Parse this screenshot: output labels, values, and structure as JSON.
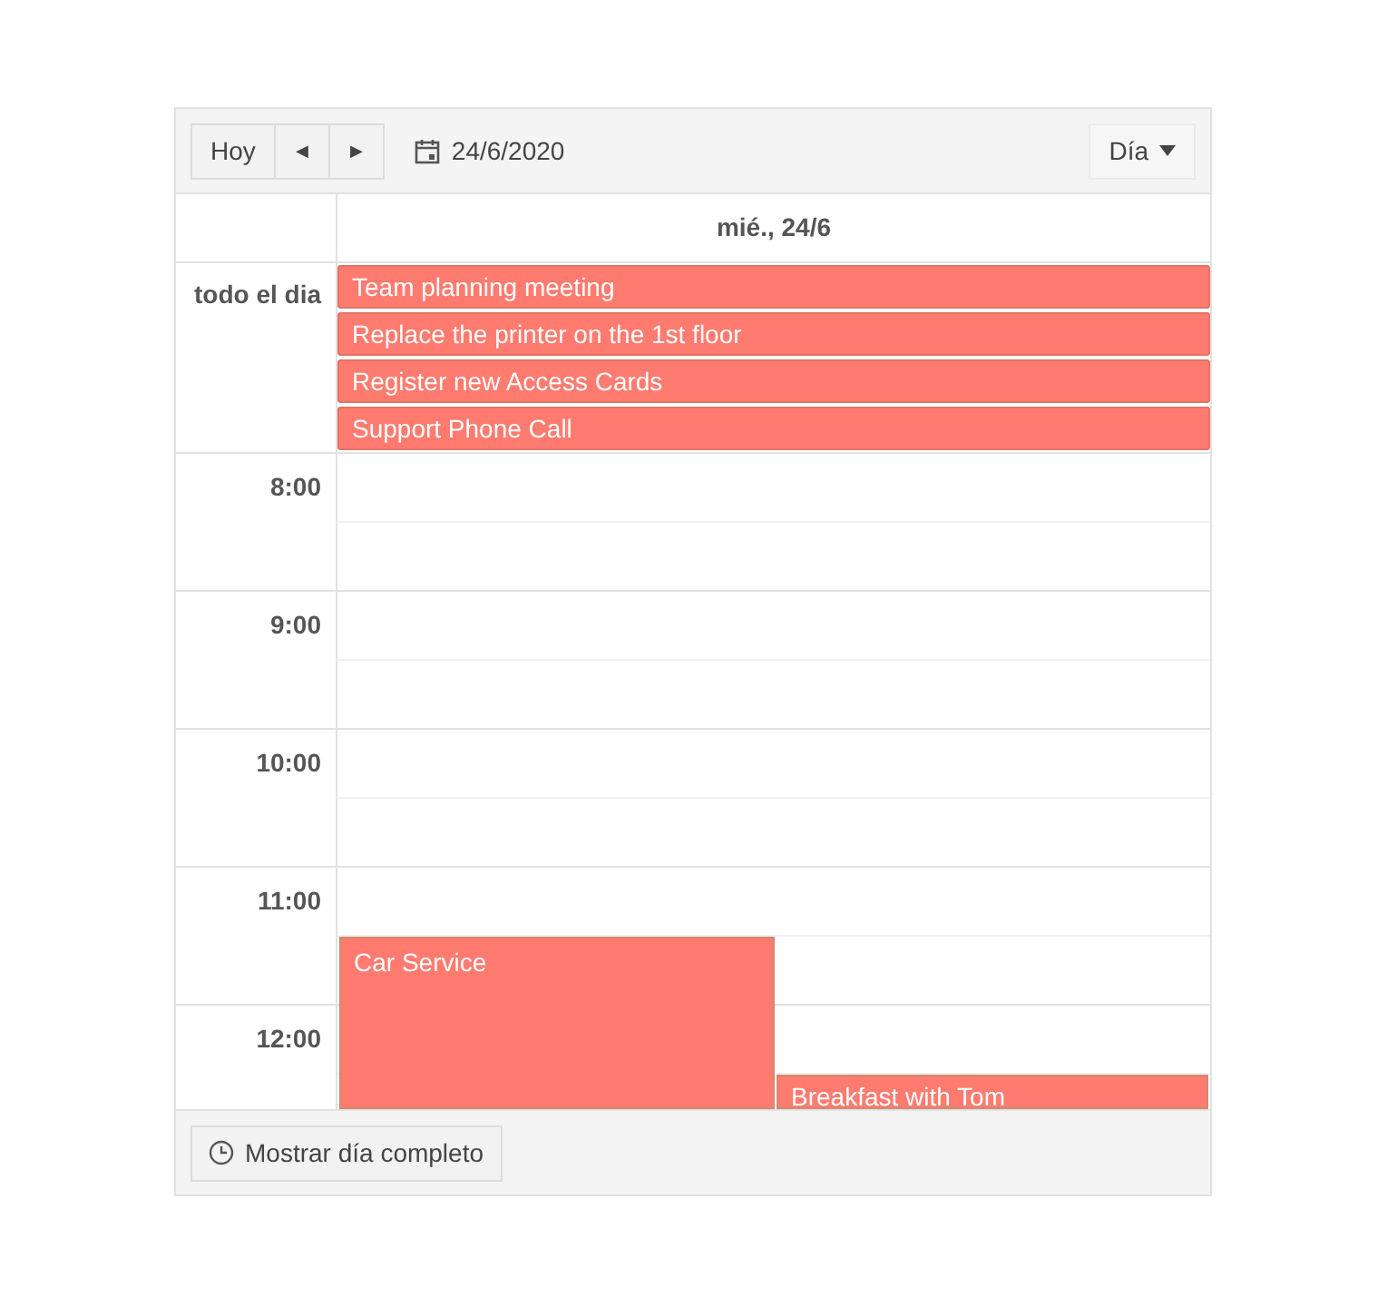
{
  "toolbar": {
    "today": "Hoy",
    "prev": "◀",
    "next": "▶",
    "date": "24/6/2020",
    "view": "Día"
  },
  "day_header": "mié., 24/6",
  "all_day": {
    "label": "todo el dia",
    "events": [
      {
        "title": "Team planning meeting"
      },
      {
        "title": "Replace the printer on the 1st floor"
      },
      {
        "title": "Register new Access Cards"
      },
      {
        "title": "Support Phone Call"
      }
    ]
  },
  "hours": [
    "8:00",
    "9:00",
    "10:00",
    "11:00",
    "12:00"
  ],
  "events": [
    {
      "title": "Car Service"
    },
    {
      "title": "Breakfast with Tom"
    }
  ],
  "footer": {
    "button": "Mostrar día completo"
  }
}
